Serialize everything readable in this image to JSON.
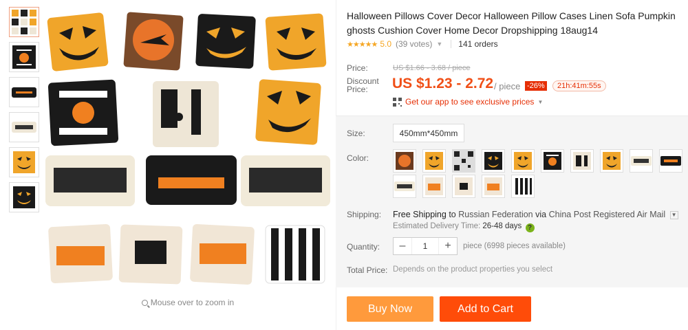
{
  "product": {
    "title": "Halloween Pillows Cover Decor Halloween Pillow Cases Linen Sofa Pumpkin ghosts Cushion Cover Home Decor Dropshipping 18aug14",
    "stars": "★★★★★",
    "rating": "5.0",
    "votes": "(39 votes)",
    "orders": "141 orders"
  },
  "gallery": {
    "zoom_hint": "Mouse over to zoom in",
    "thumbnails": [
      "collage",
      "trick-or-treat",
      "happy-halloween",
      "hocus",
      "pumpkin-face",
      "black-pumpkin"
    ]
  },
  "price": {
    "price_label": "Price:",
    "original": "US $1.66 - 3.68 / piece",
    "discount_label": "Discount Price:",
    "discounted": "US $1.23 - 2.72",
    "per_unit": "/ piece",
    "discount_pct": "-26%",
    "timer": "21h:41m:55s",
    "app_promo": "Get our app to see exclusive prices"
  },
  "specs": {
    "size_label": "Size:",
    "size_value": "450mm*450mm",
    "color_label": "Color:",
    "colors": [
      "black-on-orange",
      "pumpkin-orange",
      "qr-pattern",
      "black-pumpkin",
      "orange-pumpkin",
      "trick-or-treat",
      "number-31",
      "orange-pumpkin-2",
      "pocus",
      "happy-halloween",
      "hocus",
      "treat",
      "or",
      "trick",
      "stripes"
    ]
  },
  "shipping": {
    "label": "Shipping:",
    "free": "Free Shipping",
    "to": "to",
    "country": "Russian Federation",
    "via": "via",
    "carrier": "China Post Registered Air Mail",
    "eta_label": "Estimated Delivery Time:",
    "eta_days": "26-48 days"
  },
  "quantity": {
    "label": "Quantity:",
    "value": "1",
    "available": "piece (6998 pieces available)"
  },
  "total": {
    "label": "Total Price:",
    "value": "Depends on the product properties you select"
  },
  "actions": {
    "buy_now": "Buy Now",
    "add_to_cart": "Add to Cart"
  },
  "colors": {
    "accent": "#f04f17",
    "buy": "#ff9a3c",
    "cart": "#ff4c09",
    "star": "#f5a623",
    "pumpkin": "#f0a52a"
  }
}
